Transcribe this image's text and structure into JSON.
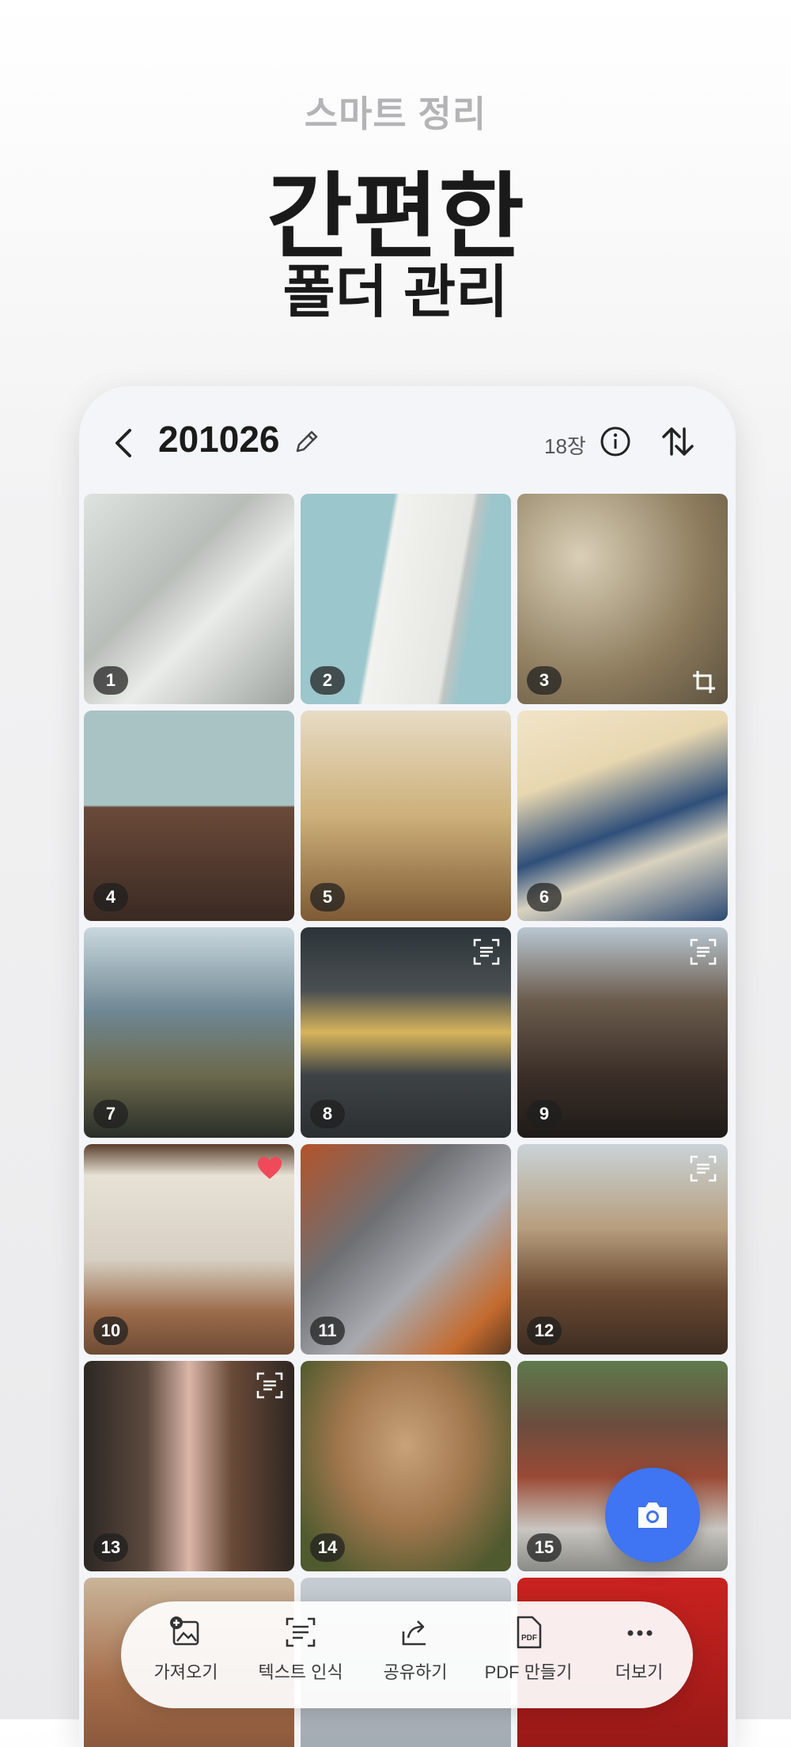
{
  "promo": {
    "eyebrow": "스마트 정리",
    "headline": "간편한",
    "subline": "폴더 관리"
  },
  "folder": {
    "title": "201026",
    "count": "18장"
  },
  "photos": [
    {
      "num": "1"
    },
    {
      "num": "2"
    },
    {
      "num": "3"
    },
    {
      "num": "4"
    },
    {
      "num": "5"
    },
    {
      "num": "6"
    },
    {
      "num": "7"
    },
    {
      "num": "8"
    },
    {
      "num": "9"
    },
    {
      "num": "10"
    },
    {
      "num": "11"
    },
    {
      "num": "12"
    },
    {
      "num": "13"
    },
    {
      "num": "14"
    },
    {
      "num": "15"
    }
  ],
  "toolbar": {
    "import": "가져오기",
    "ocr": "텍스트 인식",
    "share": "공유하기",
    "pdf": "PDF 만들기",
    "more": "더보기"
  },
  "colors": {
    "accent": "#3f74f2",
    "heart": "#f04a5a"
  }
}
